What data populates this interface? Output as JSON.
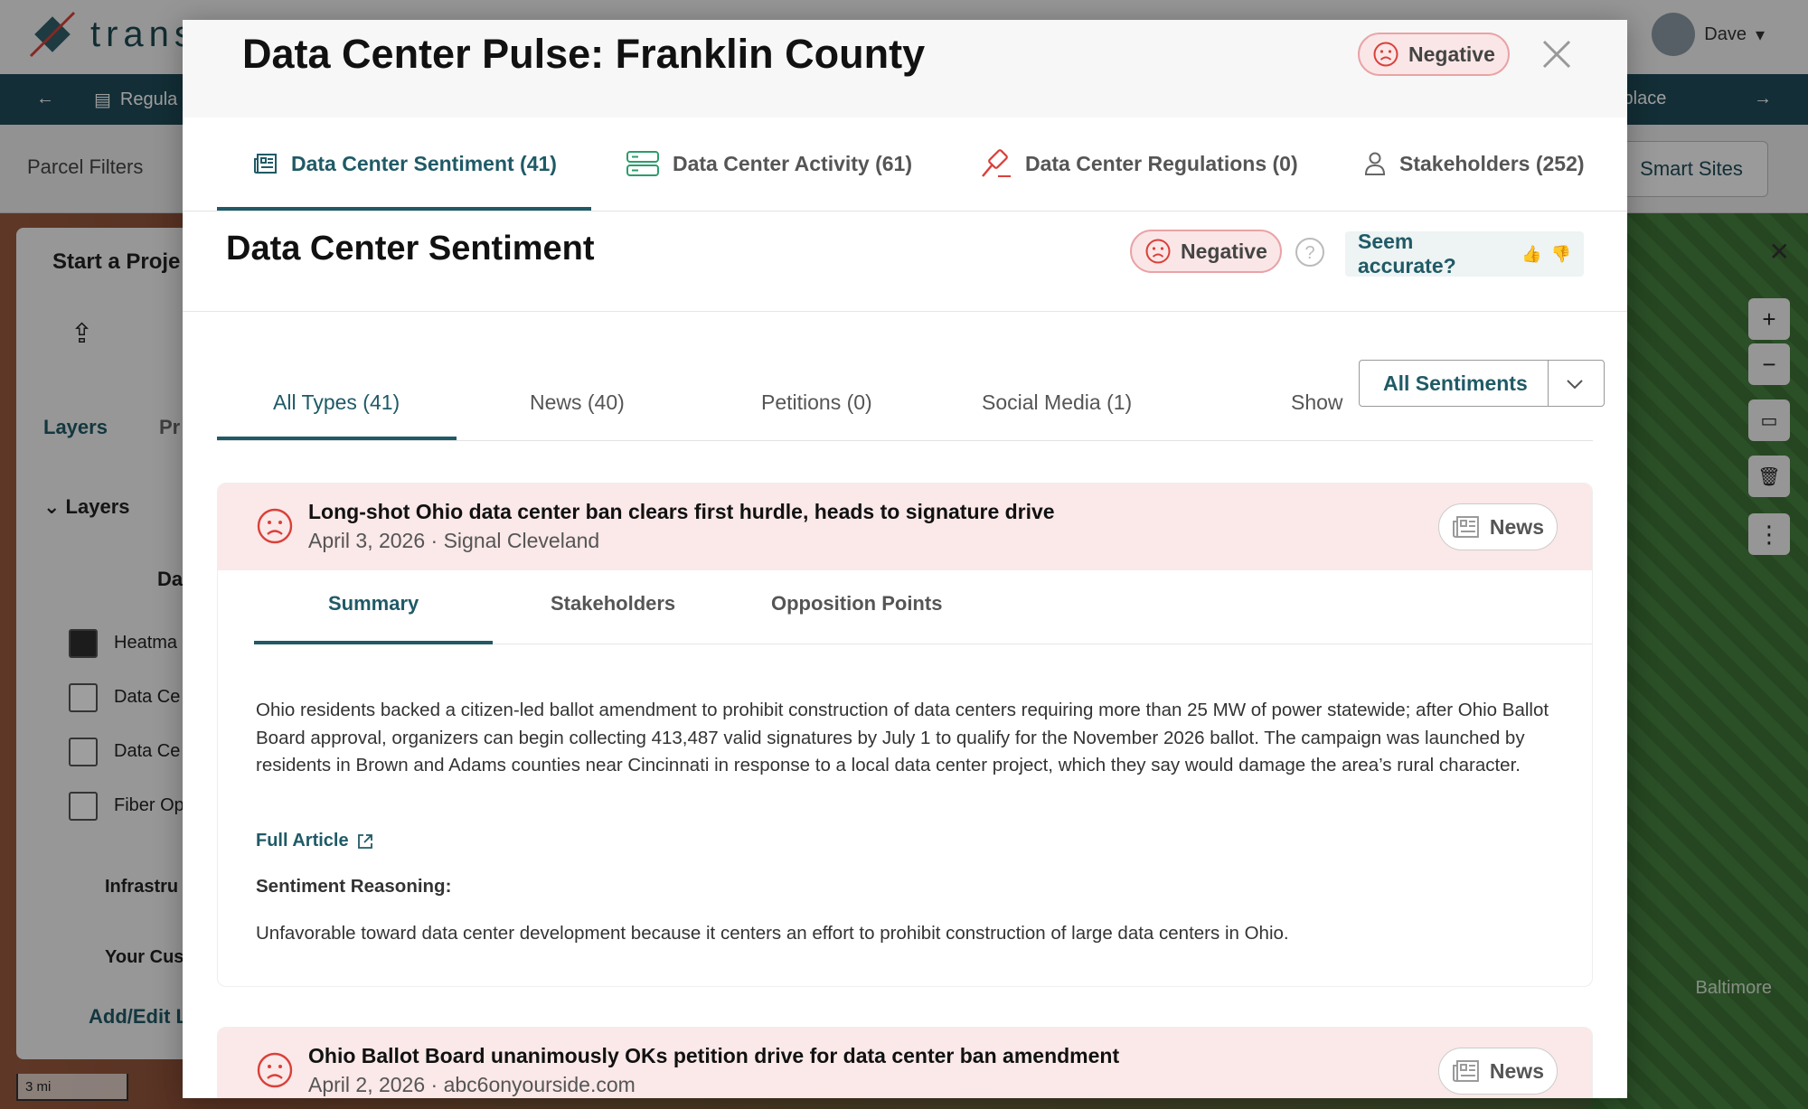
{
  "app": {
    "logo_text": "trans",
    "user_name": "Dave",
    "nav": {
      "left_item": "Regula",
      "right_item": "tplace"
    },
    "filters_label": "Parcel Filters",
    "smart_sites_label": "Smart Sites",
    "left_panel": {
      "start_project": "Start a Proje",
      "tab_layers": "Layers",
      "tab_pr": "Pr",
      "layers_header": "Layers",
      "group_label": "Da",
      "items": [
        "Heatma",
        "Data Ce",
        "Data Ce",
        "Fiber Op"
      ],
      "infra": "Infrastru",
      "custom": "Your Cus",
      "add_edit": "Add/Edit L"
    },
    "map_label": "Baltimore",
    "scale_label": "3 mi"
  },
  "modal": {
    "title": "Data Center Pulse: Franklin County",
    "header_sentiment": "Negative",
    "tabs": [
      {
        "label": "Data Center Sentiment (41)",
        "icon": "newspaper-icon"
      },
      {
        "label": "Data Center Activity (61)",
        "icon": "server-icon"
      },
      {
        "label": "Data Center Regulations (0)",
        "icon": "gavel-icon"
      },
      {
        "label": "Stakeholders (252)",
        "icon": "person-icon"
      }
    ],
    "section_title": "Data Center Sentiment",
    "section_sentiment": "Negative",
    "feedback_label": "Seem accurate?",
    "type_tabs": [
      "All Types (41)",
      "News (40)",
      "Petitions (0)",
      "Social Media (1)"
    ],
    "show_label": "Show",
    "sentiment_filter": "All Sentiments",
    "articles": [
      {
        "title": "Long-shot Ohio data center ban clears first hurdle, heads to signature drive",
        "meta": "April 3, 2026 · Signal Cleveland",
        "type": "News",
        "tabs": [
          "Summary",
          "Stakeholders",
          "Opposition Points"
        ],
        "summary": "Ohio residents backed a citizen-led ballot amendment to prohibit construction of data centers requiring more than 25 MW of power statewide; after Ohio Ballot Board approval, organizers can begin collecting 413,487 valid signatures by July 1 to qualify for the November 2026 ballot. The campaign was launched by residents in Brown and Adams counties near Cincinnati in response to a local data center project, which they say would damage the area’s rural character.",
        "link_label": "Full Article",
        "reasoning_label": "Sentiment Reasoning:",
        "reasoning": "Unfavorable toward data center development because it centers an effort to prohibit construction of large data centers in Ohio."
      },
      {
        "title": "Ohio Ballot Board unanimously OKs petition drive for data center ban amendment",
        "meta": "April 2, 2026 · abc6onyourside.com",
        "type": "News"
      }
    ]
  },
  "colors": {
    "accent": "#1f5a66",
    "negative_bg": "#fbe8e8",
    "negative_icon": "#d9403a"
  }
}
